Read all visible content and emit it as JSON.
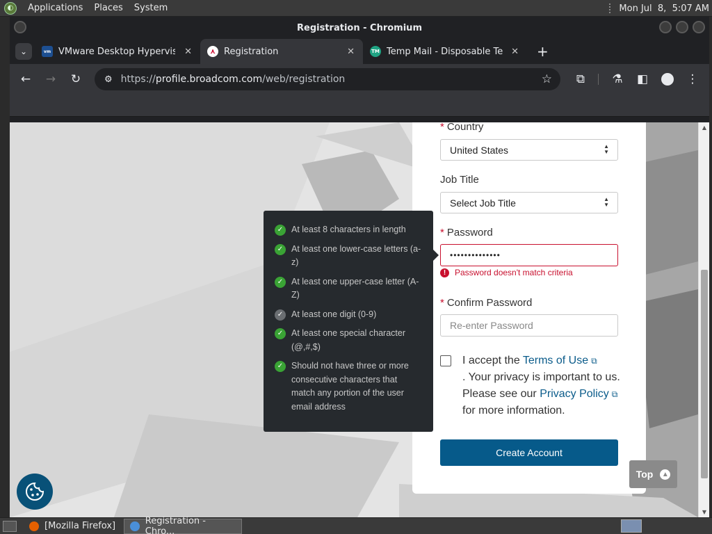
{
  "panel": {
    "menus": [
      "Applications",
      "Places",
      "System"
    ],
    "clock": "Mon Jul  8,  5:07 AM"
  },
  "window": {
    "title": "Registration - Chromium"
  },
  "tabs": [
    {
      "title": "VMware Desktop Hypervisor",
      "favicon": "vmware-icon"
    },
    {
      "title": "Registration",
      "favicon": "broadcom-icon"
    },
    {
      "title": "Temp Mail - Disposable Temp",
      "favicon": "tempmail-icon"
    }
  ],
  "address": {
    "scheme": "https://",
    "host": "profile.broadcom.com",
    "path": "/web/registration"
  },
  "form": {
    "country": {
      "label": "Country",
      "value": "United States"
    },
    "job_title": {
      "label": "Job Title",
      "value": "Select Job Title"
    },
    "password": {
      "label": "Password",
      "value": "••••••••••••••",
      "error": "Password doesn't match criteria"
    },
    "confirm_password": {
      "label": "Confirm Password",
      "placeholder": "Re-enter Password"
    },
    "terms": {
      "prefix": "I accept the ",
      "terms_link": "Terms of Use",
      "middle": ". Your privacy is important to us. Please see our ",
      "privacy_link": "Privacy Policy",
      "suffix": " for more information."
    },
    "submit": "Create Account"
  },
  "criteria": [
    {
      "text": "At least 8 characters in length",
      "met": true
    },
    {
      "text": "At least one lower-case letters (a-z)",
      "met": true
    },
    {
      "text": "At least one upper-case letter (A-Z)",
      "met": true
    },
    {
      "text": "At least one digit (0-9)",
      "met": false
    },
    {
      "text": "At least one special character (@,#,$)",
      "met": true
    },
    {
      "text": "Should not have three or more consecutive characters that match any portion of the user email address",
      "met": true
    }
  ],
  "top_button": "Top",
  "taskbar": {
    "items": [
      {
        "label": "[Mozilla Firefox]"
      },
      {
        "label": "Registration - Chro..."
      }
    ]
  },
  "colors": {
    "accent": "#065a8a",
    "error": "#c8102e",
    "check": "#3aa335"
  }
}
